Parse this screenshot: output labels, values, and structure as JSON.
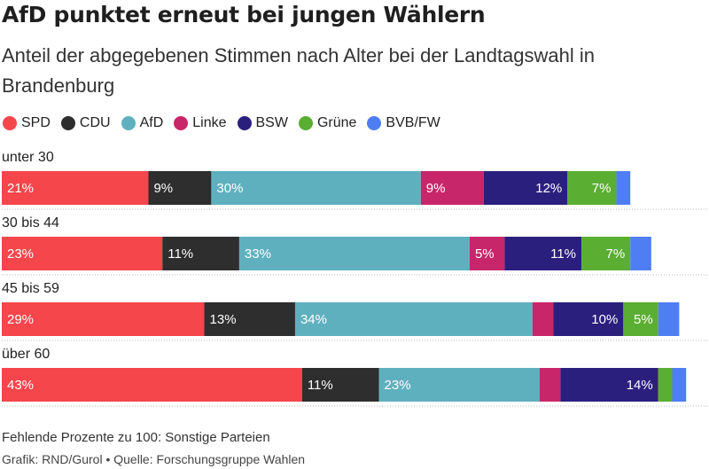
{
  "chart_data": {
    "type": "bar",
    "orientation": "horizontal",
    "stacked": true,
    "title": "AfD punktet erneut bei jungen Wählern",
    "subtitle": "Anteil der abgegebenen Stimmen nach Alter bei der Landtagswahl in Brandenburg",
    "categories": [
      "unter 30",
      "30 bis 44",
      "45 bis 59",
      "über 60"
    ],
    "xlim": [
      0,
      100
    ],
    "grid": false,
    "legend_position": "top-left",
    "series": [
      {
        "name": "SPD",
        "color": "#f4464b",
        "values": [
          21,
          23,
          29,
          43
        ],
        "labels": [
          "21%",
          "23%",
          "29%",
          "43%"
        ]
      },
      {
        "name": "CDU",
        "color": "#2e2e2e",
        "values": [
          9,
          11,
          13,
          11
        ],
        "labels": [
          "9%",
          "11%",
          "13%",
          "11%"
        ]
      },
      {
        "name": "AfD",
        "color": "#5fb0bf",
        "values": [
          30,
          33,
          34,
          23
        ],
        "labels": [
          "30%",
          "33%",
          "34%",
          "23%"
        ]
      },
      {
        "name": "Linke",
        "color": "#c8266a",
        "values": [
          9,
          5,
          3,
          3
        ],
        "labels": [
          "9%",
          "5%",
          "",
          ""
        ]
      },
      {
        "name": "BSW",
        "color": "#2b1f7e",
        "values": [
          12,
          11,
          10,
          14
        ],
        "labels": [
          "12%",
          "11%",
          "10%",
          "14%"
        ]
      },
      {
        "name": "Grüne",
        "color": "#5aae32",
        "values": [
          7,
          7,
          5,
          2
        ],
        "labels": [
          "7%",
          "7%",
          "5%",
          ""
        ]
      },
      {
        "name": "BVB/FW",
        "color": "#4f7ef4",
        "values": [
          2,
          3,
          3,
          2
        ],
        "labels": [
          "",
          "",
          "",
          ""
        ]
      }
    ],
    "footnote": "Fehlende Prozente zu 100: Sonstige Parteien",
    "source": "Grafik: RND/Gurol • Quelle: Forschungsgruppe Wahlen"
  }
}
